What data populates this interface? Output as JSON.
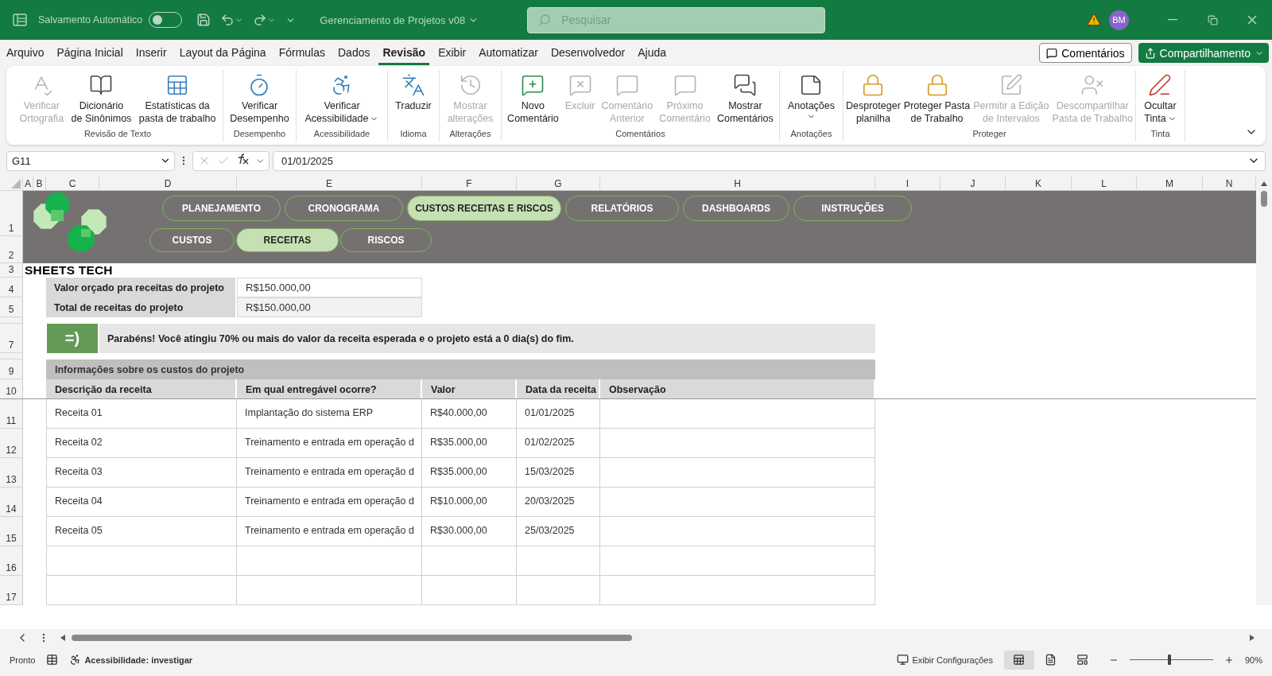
{
  "title_bar": {
    "autosave_label": "Salvamento Automático",
    "autosave_on": false,
    "document_title": "Gerenciamento de Projetos v08",
    "search": {
      "placeholder": "Pesquisar"
    },
    "avatar": "BM"
  },
  "menu_tabs": [
    {
      "label": "Arquivo",
      "selected": false
    },
    {
      "label": "Página Inicial",
      "selected": false
    },
    {
      "label": "Inserir",
      "selected": false
    },
    {
      "label": "Layout da Página",
      "selected": false
    },
    {
      "label": "Fórmulas",
      "selected": false
    },
    {
      "label": "Dados",
      "selected": false
    },
    {
      "label": "Revisão",
      "selected": true
    },
    {
      "label": "Exibir",
      "selected": false
    },
    {
      "label": "Automatizar",
      "selected": false
    },
    {
      "label": "Desenvolvedor",
      "selected": false
    },
    {
      "label": "Ajuda",
      "selected": false
    }
  ],
  "header_buttons": {
    "comments": "Comentários",
    "share": "Compartilhamento"
  },
  "ribbon": {
    "groups": [
      {
        "label": "Revisão de Texto",
        "buttons": [
          {
            "lines": [
              "Verificar",
              "Ortografia"
            ],
            "disabled": true,
            "dropdown": false
          },
          {
            "lines": [
              "Dicionário",
              "de Sinônimos"
            ],
            "disabled": false,
            "dropdown": false
          },
          {
            "lines": [
              "Estatísticas da",
              "pasta de trabalho"
            ],
            "disabled": false,
            "dropdown": false
          }
        ]
      },
      {
        "label": "Desempenho",
        "buttons": [
          {
            "lines": [
              "Verificar",
              "Desempenho"
            ],
            "disabled": false,
            "dropdown": false
          }
        ]
      },
      {
        "label": "Acessibilidade",
        "buttons": [
          {
            "lines": [
              "Verificar",
              "Acessibilidade"
            ],
            "disabled": false,
            "dropdown": true
          }
        ]
      },
      {
        "label": "Idioma",
        "buttons": [
          {
            "lines": [
              "Traduzir"
            ],
            "disabled": false,
            "dropdown": false
          }
        ]
      },
      {
        "label": "Alterações",
        "buttons": [
          {
            "lines": [
              "Mostrar",
              "alterações"
            ],
            "disabled": true,
            "dropdown": false
          }
        ]
      },
      {
        "label": "Comentários",
        "buttons": [
          {
            "lines": [
              "Novo",
              "Comentário"
            ],
            "disabled": false,
            "dropdown": false
          },
          {
            "lines": [
              "Excluir"
            ],
            "disabled": true,
            "dropdown": false
          },
          {
            "lines": [
              "Comentário",
              "Anterior"
            ],
            "disabled": true,
            "dropdown": false
          },
          {
            "lines": [
              "Próximo",
              "Comentário"
            ],
            "disabled": true,
            "dropdown": false
          },
          {
            "lines": [
              "Mostrar",
              "Comentários"
            ],
            "disabled": false,
            "dropdown": false
          }
        ]
      },
      {
        "label": "Anotações",
        "buttons": [
          {
            "lines": [
              "Anotações"
            ],
            "disabled": false,
            "dropdown": true
          }
        ]
      },
      {
        "label": "Proteger",
        "buttons": [
          {
            "lines": [
              "Desproteger",
              "planilha"
            ],
            "disabled": false,
            "dropdown": false
          },
          {
            "lines": [
              "Proteger Pasta",
              "de Trabalho"
            ],
            "disabled": false,
            "dropdown": false
          },
          {
            "lines": [
              "Permitir a Edição",
              "de Intervalos"
            ],
            "disabled": true,
            "dropdown": false
          },
          {
            "lines": [
              "Descompartilhar",
              "Pasta de Trabalho"
            ],
            "disabled": true,
            "dropdown": false
          }
        ]
      },
      {
        "label": "Tinta",
        "buttons": [
          {
            "lines": [
              "Ocultar",
              "Tinta"
            ],
            "disabled": false,
            "dropdown": true
          }
        ]
      }
    ]
  },
  "formula_bar": {
    "name_box": "G11",
    "formula": "01/01/2025"
  },
  "sheet": {
    "column_headers": [
      "A",
      "B",
      "C",
      "D",
      "E",
      "F",
      "G",
      "H",
      "I",
      "J",
      "K",
      "L",
      "M",
      "N"
    ],
    "row_headers": [
      "1",
      "2",
      "3",
      "4",
      "5",
      "7",
      "9",
      "10",
      "11",
      "12",
      "13",
      "14",
      "15",
      "16",
      "17"
    ],
    "banner": {
      "brand": "SHEETS TECH",
      "nav_primary": [
        {
          "label": "PLANEJAMENTO",
          "selected": false
        },
        {
          "label": "CRONOGRAMA",
          "selected": false
        },
        {
          "label": "CUSTOS RECEITAS E RISCOS",
          "selected": true
        },
        {
          "label": "RELATÓRIOS",
          "selected": false
        },
        {
          "label": "DASHBOARDS",
          "selected": false
        },
        {
          "label": "INSTRUÇÕES",
          "selected": false
        }
      ],
      "nav_secondary": [
        {
          "label": "CUSTOS",
          "selected": false
        },
        {
          "label": "RECEITAS",
          "selected": true
        },
        {
          "label": "RISCOS",
          "selected": false
        }
      ]
    },
    "summary": [
      {
        "label": "Valor orçado pra receitas do projeto",
        "value": "R$150.000,00"
      },
      {
        "label": "Total de receitas do projeto",
        "value": "R$150.000,00"
      }
    ],
    "alert": {
      "emoticon": "=)",
      "message": "Parabéns! Você atingiu 70% ou mais do valor da receita esperada e o projeto está a 0 dia(s) do fim."
    },
    "table": {
      "title": "Informações sobre os custos do projeto",
      "columns": [
        "Descrição da receita",
        "Em qual entregável ocorre?",
        "Valor",
        "Data da receita",
        "Observação"
      ],
      "rows": [
        [
          "Receita 01",
          "Implantação do sistema ERP",
          "R$40.000,00",
          "01/01/2025"
        ],
        [
          "Receita 02",
          "Treinamento e entrada em operação d",
          "R$35.000,00",
          "01/02/2025"
        ],
        [
          "Receita 03",
          "Treinamento e entrada em operação d",
          "R$35.000,00",
          "15/03/2025"
        ],
        [
          "Receita 04",
          "Treinamento e entrada em operação d",
          "R$10.000,00",
          "20/03/2025"
        ],
        [
          "Receita 05",
          "Treinamento e entrada em operação d",
          "R$30.000,00",
          "25/03/2025"
        ]
      ]
    }
  },
  "status_bar": {
    "ready": "Pronto",
    "accessibility": "Acessibilidade: investigar",
    "display_settings": "Exibir Configurações",
    "views": [
      {
        "selected": true
      },
      {
        "selected": false
      },
      {
        "selected": false
      }
    ],
    "zoom": {
      "level": 0.48,
      "reading": "90%"
    }
  }
}
